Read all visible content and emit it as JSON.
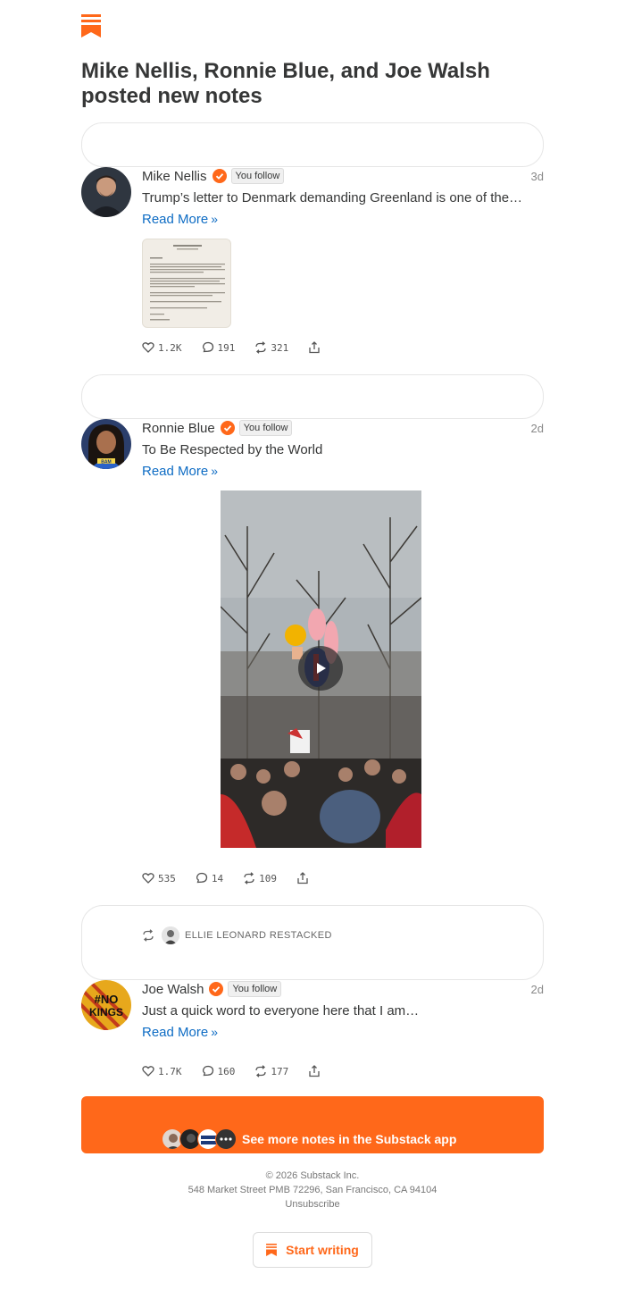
{
  "headline": "Mike Nellis, Ronnie Blue, and Joe Walsh posted new notes",
  "colors": {
    "brand": "#ff681a",
    "link": "#0e6cc4",
    "text": "#363737"
  },
  "notes": [
    {
      "author": "Mike Nellis",
      "follow_badge": "You follow",
      "time": "3d",
      "text": "Trump’s letter to Denmark demanding Greenland is one of the…",
      "read_more": "Read More",
      "attachment": "letter-document-thumbnail",
      "likes": "1.2K",
      "comments": "191",
      "restacks": "321"
    },
    {
      "author": "Ronnie Blue",
      "follow_badge": "You follow",
      "time": "2d",
      "text": "To Be Respected by the World",
      "read_more": "Read More",
      "attachment": "video-thumbnail",
      "likes": "535",
      "comments": "14",
      "restacks": "109"
    },
    {
      "restacked_by": "ELLIE LEONARD RESTACKED",
      "author": "Joe Walsh",
      "follow_badge": "You follow",
      "time": "2d",
      "text": "Just a quick word to everyone here that I am…",
      "read_more": "Read More",
      "likes": "1.7K",
      "comments": "160",
      "restacks": "177"
    }
  ],
  "cta": {
    "label": "See more notes in the Substack app"
  },
  "footer": {
    "copyright": "© 2026 Substack Inc.",
    "address": "548 Market Street PMB 72296, San Francisco, CA 94104",
    "unsubscribe": "Unsubscribe"
  },
  "start_writing": "Start writing"
}
